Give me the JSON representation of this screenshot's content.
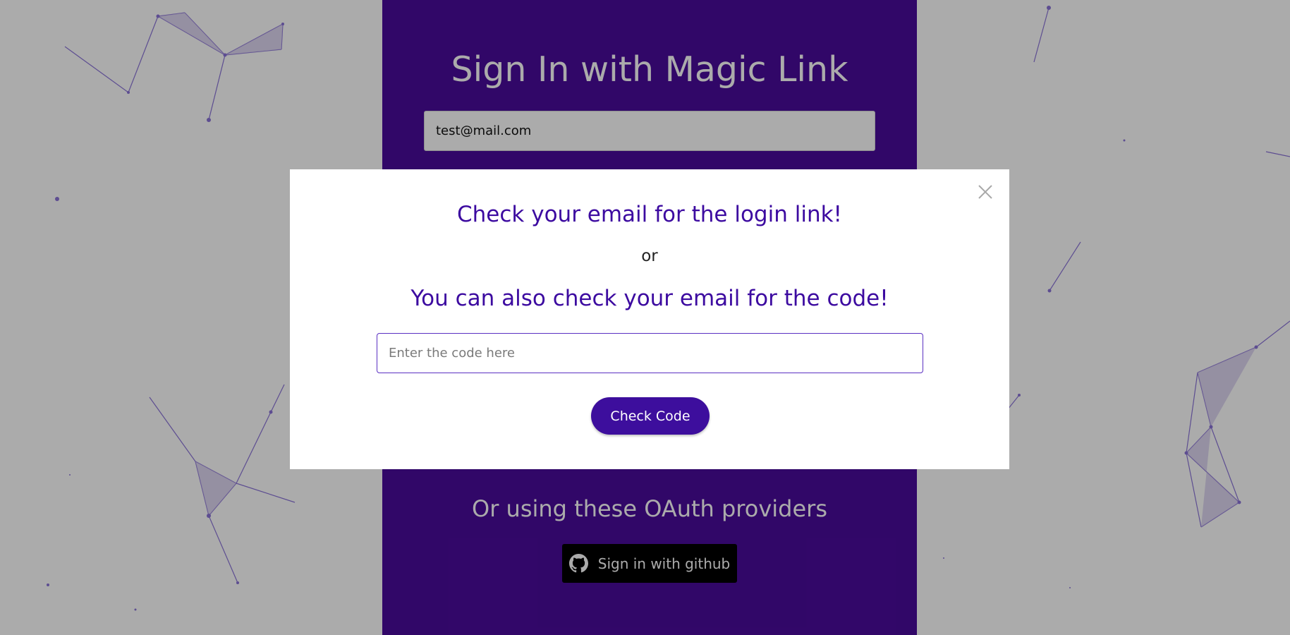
{
  "page": {
    "title": "Sign In with Magic Link",
    "email_value": "test@mail.com",
    "oauth_heading": "Or using these OAuth providers",
    "github_button_label": "Sign in with github"
  },
  "modal": {
    "title": "Check your email for the login link!",
    "or_text": "or",
    "subtitle": "You can also check your email for the code!",
    "code_placeholder": "Enter the code here",
    "code_value": "",
    "check_button_label": "Check Code"
  },
  "icons": {
    "github": "github-icon",
    "close": "close-icon"
  },
  "colors": {
    "brand_purple": "#4a0b9c",
    "modal_heading": "#3c0aa0",
    "button_purple": "#3d0e9d",
    "overlay": "rgba(0,0,0,0.33)"
  }
}
